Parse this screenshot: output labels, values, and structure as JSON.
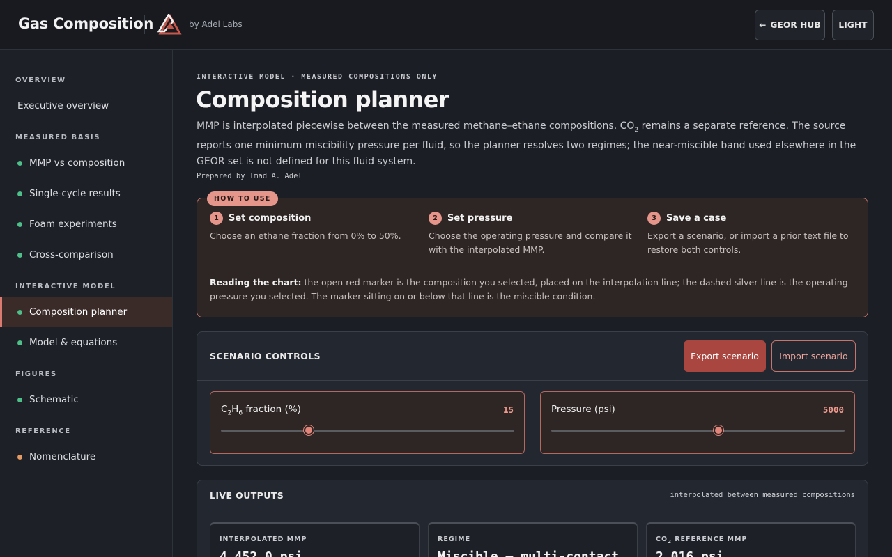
{
  "header": {
    "title": "Gas Composition",
    "by_label": "by Adel Labs",
    "hub_label": "GEOR HUB",
    "theme_label": "LIGHT",
    "colors": {
      "accent": "#e6958b",
      "logo_red": "#c7564b"
    }
  },
  "sidebar": {
    "sections": {
      "overview": "OVERVIEW",
      "measured": "MEASURED BASIS",
      "interactive": "INTERACTIVE MODEL",
      "figures": "FIGURES",
      "reference": "REFERENCE"
    },
    "items": {
      "executive": "Executive overview",
      "mmp": "MMP vs composition",
      "single_cycle": "Single-cycle results",
      "foam": "Foam experiments",
      "cross": "Cross-comparison",
      "planner": "Composition planner",
      "model": "Model & equations",
      "schematic": "Schematic",
      "nomenclature": "Nomenclature"
    }
  },
  "main": {
    "eyebrow": "INTERACTIVE MODEL · MEASURED COMPOSITIONS ONLY",
    "title": "Composition planner",
    "desc_a": "MMP is interpolated piecewise between the measured methane–ethane compositions. CO",
    "desc_sub": "2",
    "desc_b": " remains a separate reference. The source reports one minimum miscibility pressure per fluid, so the planner resolves two regimes; the near-miscible band used elsewhere in the GEOR set is not defined for this fluid system.",
    "prepared": "Prepared by Imad A. Adel"
  },
  "howto": {
    "badge": "HOW TO USE",
    "steps": [
      {
        "num": "1",
        "title": "Set composition",
        "text": "Choose an ethane fraction from 0% to 50%."
      },
      {
        "num": "2",
        "title": "Set pressure",
        "text": "Choose the operating pressure and compare it with the interpolated MMP."
      },
      {
        "num": "3",
        "title": "Save a case",
        "text": "Export a scenario, or import a prior text file to restore both controls."
      }
    ],
    "reading_label": "Reading the chart:",
    "reading_text": " the open red marker is the composition you selected, placed on the interpolation line; the dashed silver line is the operating pressure you selected. The marker sitting on or below that line is the miscible condition."
  },
  "controls": {
    "title": "SCENARIO CONTROLS",
    "export_label": "Export scenario",
    "import_label": "Import scenario",
    "ethane": {
      "label_a": "C",
      "sub1": "2",
      "label_b": "H",
      "sub2": "6",
      "label_c": " fraction (%)",
      "value": "15",
      "min": 0,
      "max": 50,
      "level": 15
    },
    "pressure": {
      "label": "Pressure (psi)",
      "value": "5000",
      "level_fraction": 0.57
    }
  },
  "outputs": {
    "title": "LIVE OUTPUTS",
    "note": "interpolated between measured compositions",
    "cards": [
      {
        "label": "INTERPOLATED MMP",
        "value": "4,452.0 psi"
      },
      {
        "label": "REGIME",
        "value": "Miscible — multi-contact"
      },
      {
        "label_a": "CO",
        "label_sub": "2",
        "label_b": " REFERENCE MMP",
        "value": "2,016 psi"
      }
    ]
  }
}
